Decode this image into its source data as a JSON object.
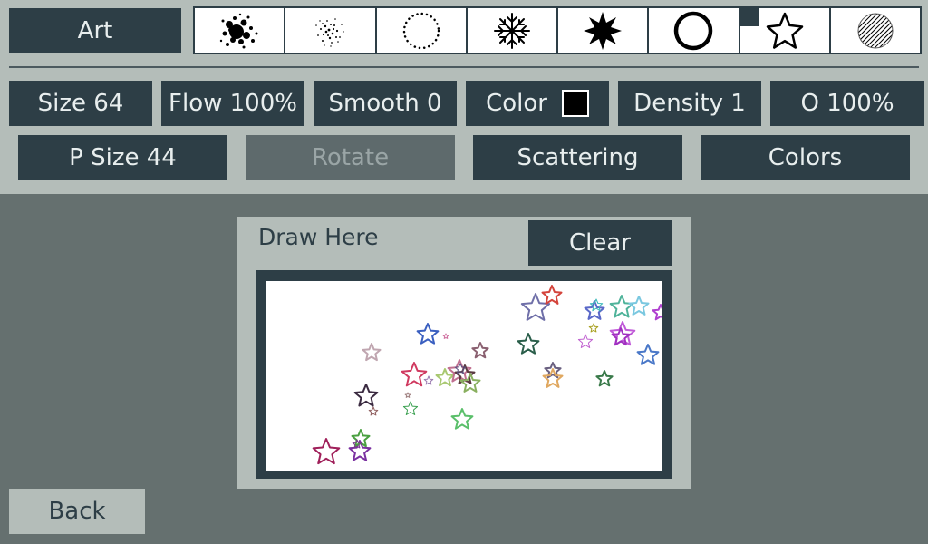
{
  "toolbar": {
    "mode_label": "Art",
    "brushes": [
      {
        "icon": "splatter-brush-icon"
      },
      {
        "icon": "spray-brush-icon"
      },
      {
        "icon": "dotted-circle-brush-icon"
      },
      {
        "icon": "snowflake-brush-icon"
      },
      {
        "icon": "star-burst-brush-icon"
      },
      {
        "icon": "ring-brush-icon"
      },
      {
        "icon": "star-outline-brush-icon",
        "selected": true
      },
      {
        "icon": "hatched-circle-brush-icon"
      }
    ]
  },
  "controls": {
    "size_label": "Size 64",
    "flow_label": "Flow 100%",
    "smooth_label": "Smooth 0",
    "color_label": "Color",
    "color_value": "#000000",
    "density_label": "Density 1",
    "opacity_label": "O 100%",
    "psize_label": "P Size 44",
    "rotate_label": "Rotate",
    "scattering_label": "Scattering",
    "colors_label": "Colors"
  },
  "draw_area": {
    "label": "Draw Here",
    "clear_label": "Clear"
  },
  "footer": {
    "back_label": "Back"
  },
  "theme": {
    "accent": "#2d3e46",
    "panel": "#b4bdb9",
    "background": "#65706f"
  }
}
